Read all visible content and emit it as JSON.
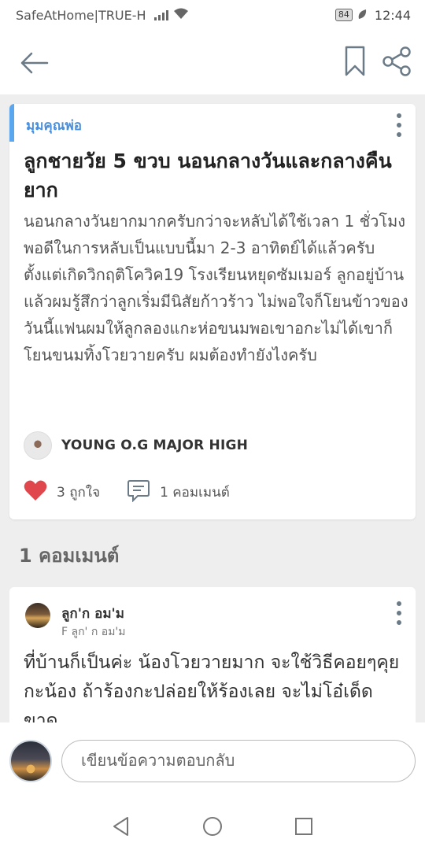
{
  "status_bar": {
    "carrier": "SafeAtHome|TRUE-H",
    "battery": "84",
    "time": "12:44"
  },
  "post": {
    "category": "มุมคุณพ่อ",
    "title": "ลูกชายวัย 5 ขวบ นอนกลางวันและกลางคืนยาก",
    "body": "นอนกลางวันยากมากครับกว่าจะหลับได้ใช้เวลา 1 ชั่วโมงพอดีในการหลับเป็นแบบนี้มา 2-3 อาทิตย์ได้แล้วครับ ตั้งแต่เกิดวิกฤติโควิค19 โรงเรียนหยุดซัมเมอร์ ลูกอยู่บ้านแล้วผมรู้สึกว่าลูกเริ่มมีนิสัยก้าวร้าว ไม่พอใจก็โยนข้าวของ วันนี้แฟนผมให้ลูกลองแกะห่อขนมพอเขาอกะไม่ได้เขาก็โยนขนมทิ้งโวยวายครับ ผมต้องทำยังไงครับ",
    "author": "YOUNG O.G MAJOR HIGH",
    "likes_label": "3 ถูกใจ",
    "comments_label": "1 คอมเมนต์"
  },
  "comments_section": {
    "heading": "1 คอมเมนต์"
  },
  "comment": {
    "name": "ลูก'ก อม'ม",
    "sub": "F ลูก' ก อม'ม",
    "body": "ที่บ้านก็เป็นค่ะ น้องโวยวายมาก จะใช้วิธีคอยๆคุยกะน้อง ถ้าร้องกะปล่อยให้ร้องเลย จะไม่โอ๋เด็ดขาด"
  },
  "reply": {
    "placeholder": "เขียนข้อความตอบกลับ"
  },
  "colors": {
    "accent": "#5aa7f0",
    "category": "#4a8fdc",
    "heart": "#e0474c",
    "icon": "#6b7a87"
  }
}
